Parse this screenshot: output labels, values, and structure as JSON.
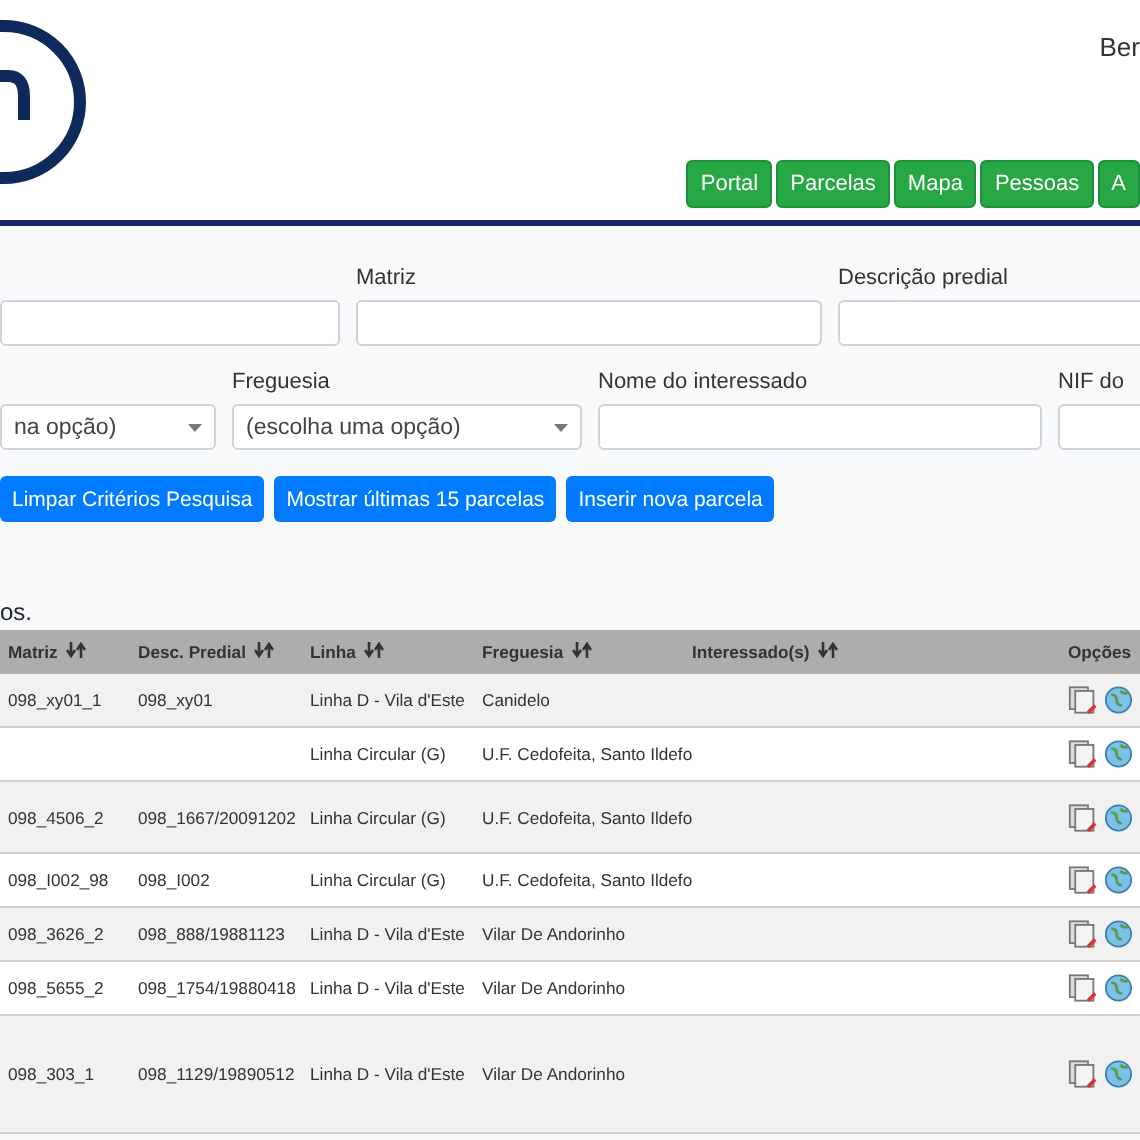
{
  "header": {
    "user_text": "Ber",
    "nav": [
      {
        "label": "Portal"
      },
      {
        "label": "Parcelas"
      },
      {
        "label": "Mapa"
      },
      {
        "label": "Pessoas"
      },
      {
        "label": "A"
      }
    ]
  },
  "filters": [
    [
      {
        "kind": "input"
      },
      {
        "kind": "input",
        "label": "Matriz"
      },
      {
        "kind": "input",
        "label": "Descrição predial"
      }
    ],
    [
      {
        "kind": "select",
        "value": "na opção)"
      },
      {
        "kind": "select",
        "label": "Freguesia",
        "value": "(escolha uma opção)"
      },
      {
        "kind": "input",
        "label": "Nome do interessado"
      },
      {
        "kind": "input",
        "label": "NIF do"
      }
    ]
  ],
  "actions": [
    "Limpar Critérios Pesquisa",
    "Mostrar últimas 15 parcelas",
    "Inserir nova parcela"
  ],
  "result_text": "os.",
  "table": {
    "columns": [
      {
        "label": "Matriz",
        "sortable": true
      },
      {
        "label": "Desc. Predial",
        "sortable": true
      },
      {
        "label": "Linha",
        "sortable": true
      },
      {
        "label": "Freguesia",
        "sortable": true
      },
      {
        "label": "Interessado(s)",
        "sortable": true
      },
      {
        "label": "Opções"
      }
    ],
    "rows": [
      {
        "cells": [
          "098_xy01_1",
          "098_xy01",
          "Linha D - Vila d'Este",
          "Canidelo"
        ]
      },
      {
        "cells": [
          "",
          "",
          "Linha Circular (G)",
          "U.F. Cedofeita, Santo Ildefo"
        ]
      },
      {
        "cells": [
          "098_4506_2",
          "098_1667/20091202",
          "Linha Circular (G)",
          "U.F. Cedofeita, Santo Ildefo"
        ]
      },
      {
        "cells": [
          "098_I002_98",
          "098_I002",
          "Linha Circular (G)",
          "U.F. Cedofeita, Santo Ildefo"
        ]
      },
      {
        "cells": [
          "098_3626_2",
          "098_888/19881123",
          "Linha D - Vila d'Este",
          "Vilar De Andorinho"
        ]
      },
      {
        "cells": [
          "098_5655_2",
          "098_1754/19880418",
          "Linha D - Vila d'Este",
          "Vilar De Andorinho"
        ]
      },
      {
        "cells": [
          "098_303_1",
          "098_1129/19890512",
          "Linha D - Vila d'Este",
          "Vilar De Andorinho"
        ]
      }
    ]
  }
}
